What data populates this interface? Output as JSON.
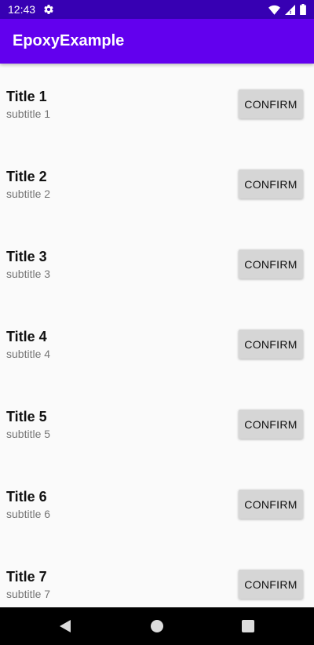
{
  "status_bar": {
    "time": "12:43",
    "icons": [
      "settings-gear-icon",
      "wifi-icon",
      "cellular-signal-icon",
      "battery-icon"
    ]
  },
  "app_bar": {
    "title": "EpoxyExample",
    "color": "#6200ee",
    "status_color": "#3700b3"
  },
  "list": {
    "items": [
      {
        "title": "Title 1",
        "subtitle": "subtitle 1",
        "button": "CONFIRM"
      },
      {
        "title": "Title 2",
        "subtitle": "subtitle 2",
        "button": "CONFIRM"
      },
      {
        "title": "Title 3",
        "subtitle": "subtitle 3",
        "button": "CONFIRM"
      },
      {
        "title": "Title 4",
        "subtitle": "subtitle 4",
        "button": "CONFIRM"
      },
      {
        "title": "Title 5",
        "subtitle": "subtitle 5",
        "button": "CONFIRM"
      },
      {
        "title": "Title 6",
        "subtitle": "subtitle 6",
        "button": "CONFIRM"
      },
      {
        "title": "Title 7",
        "subtitle": "subtitle 7",
        "button": "CONFIRM"
      }
    ]
  },
  "nav_bar": {
    "icons": [
      "back-icon",
      "home-icon",
      "recents-icon"
    ]
  }
}
